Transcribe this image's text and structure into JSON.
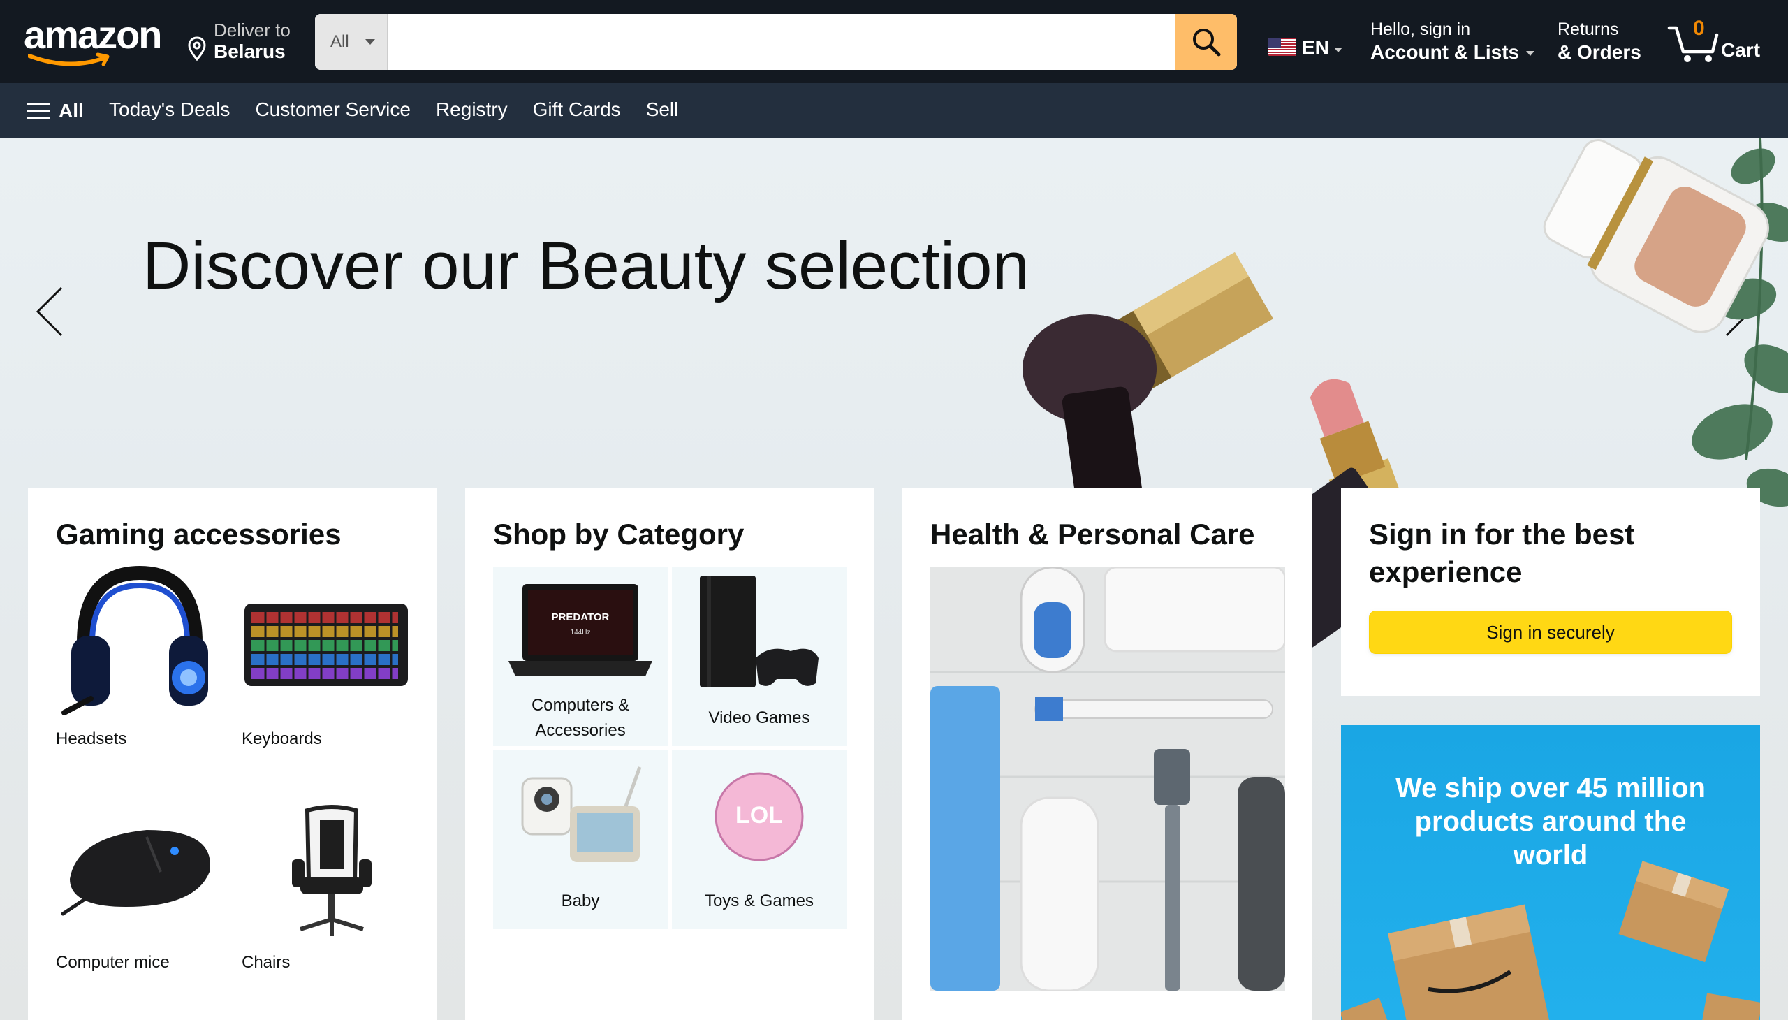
{
  "header": {
    "logo_text": "amazon",
    "deliver_line1": "Deliver to",
    "deliver_line2": "Belarus",
    "search_category": "All",
    "search_placeholder": "",
    "language": "EN",
    "account_line1": "Hello, sign in",
    "account_line2": "Account & Lists",
    "returns_line1": "Returns",
    "returns_line2": "& Orders",
    "cart_count": "0",
    "cart_label": "Cart"
  },
  "subnav": {
    "all_label": "All",
    "links": [
      "Today's Deals",
      "Customer Service",
      "Registry",
      "Gift Cards",
      "Sell"
    ]
  },
  "hero": {
    "title": "Discover our Beauty selection"
  },
  "cards": {
    "gaming": {
      "title": "Gaming accessories",
      "items": [
        "Headsets",
        "Keyboards",
        "Computer mice",
        "Chairs"
      ]
    },
    "category": {
      "title": "Shop by Category",
      "items": [
        "Computers &\nAccessories",
        "Video Games",
        "Baby",
        "Toys & Games"
      ]
    },
    "health": {
      "title": "Health & Personal Care"
    },
    "signin": {
      "title": "Sign in for the best experience",
      "button": "Sign in securely"
    },
    "ship": {
      "text": "We ship over 45 million products around the world"
    }
  },
  "colors": {
    "nav_dark": "#131921",
    "nav_sub": "#232f3e",
    "search_button": "#febd69",
    "cart_count": "#f08804",
    "signin_button": "#ffd814",
    "ship_banner": "#1aa6e4"
  },
  "icons": [
    "location-pin-icon",
    "search-icon",
    "us-flag-icon",
    "cart-icon",
    "hamburger-icon",
    "chevron-left-icon",
    "chevron-right-icon"
  ]
}
